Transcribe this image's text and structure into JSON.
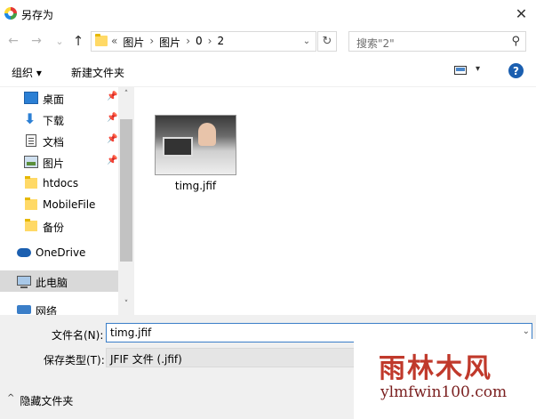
{
  "window": {
    "title": "另存为",
    "close_glyph": "✕"
  },
  "navigation": {
    "back_glyph": "←",
    "forward_glyph": "→",
    "recent_glyph": "⌄",
    "up_glyph": "↑",
    "address": {
      "overflow": "«",
      "crumbs": [
        "图片",
        "图片",
        "0",
        "2"
      ],
      "separator": "›",
      "dropdown_glyph": "⌄"
    },
    "refresh_glyph": "↻",
    "search": {
      "placeholder": "搜索\"2\"",
      "icon": "search-icon"
    }
  },
  "toolbar": {
    "organize_label": "组织 ▾",
    "new_folder_label": "新建文件夹",
    "view_dropdown_glyph": "▾",
    "help_label": "?"
  },
  "sidebar": {
    "items": [
      {
        "label": "桌面",
        "icon": "desktop-icon",
        "pinned": true
      },
      {
        "label": "下载",
        "icon": "download-icon",
        "pinned": true
      },
      {
        "label": "文档",
        "icon": "document-icon",
        "pinned": true
      },
      {
        "label": "图片",
        "icon": "pictures-icon",
        "pinned": true
      },
      {
        "label": "htdocs",
        "icon": "folder-icon",
        "pinned": false
      },
      {
        "label": "MobileFile",
        "icon": "folder-icon",
        "pinned": false
      },
      {
        "label": "备份",
        "icon": "folder-icon",
        "pinned": false
      },
      {
        "label": "OneDrive",
        "icon": "onedrive-icon",
        "pinned": false
      },
      {
        "label": "此电脑",
        "icon": "computer-icon",
        "pinned": false,
        "selected": true
      },
      {
        "label": "网络",
        "icon": "network-icon",
        "pinned": false
      }
    ],
    "pin_glyph": "📌",
    "scroll_up_glyph": "˄",
    "scroll_down_glyph": "˅"
  },
  "files": [
    {
      "name": "timg.jfif",
      "icon": "image-thumbnail"
    }
  ],
  "save": {
    "filename_label": "文件名(N):",
    "filename_value": "timg.jfif",
    "filename_dropdown": "⌄",
    "filetype_label": "保存类型(T):",
    "filetype_value": "JFIF 文件 (.jfif)",
    "hide_folders_arrow": "^",
    "hide_folders_label": "隐藏文件夹"
  },
  "watermark": {
    "title": "雨林木风",
    "url": "ylmfwin100.com"
  },
  "colors": {
    "accent": "#1b5fb0",
    "selection": "#d9d9d9",
    "footer_bg": "#f0f0f0"
  }
}
